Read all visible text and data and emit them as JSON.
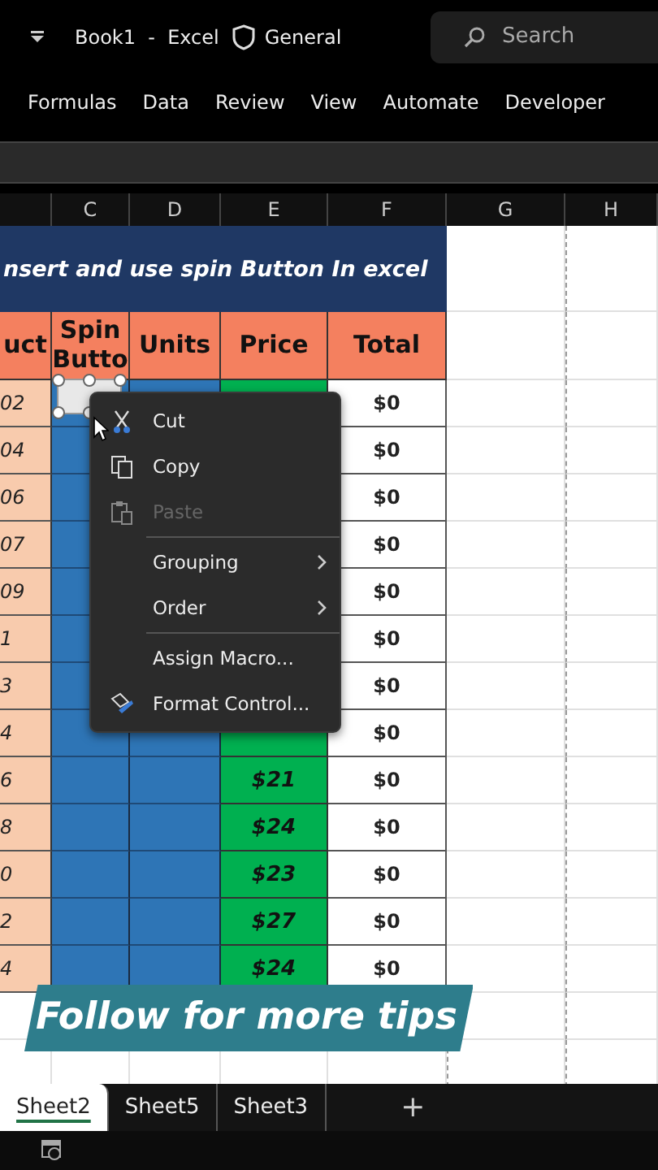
{
  "title_bar": {
    "title": "Book1  -  Excel",
    "sensitivity": "General",
    "search": {
      "placeholder": "Search"
    }
  },
  "ribbon": {
    "tabs": [
      "Formulas",
      "Data",
      "Review",
      "View",
      "Automate",
      "Developer"
    ]
  },
  "columns": [
    "C",
    "D",
    "E",
    "F",
    "G",
    "H"
  ],
  "sheet": {
    "title": "nsert and use spin Button In excel",
    "headers": [
      "uct",
      "Spin Butto",
      "Units",
      "Price",
      "Total"
    ],
    "spin_button": {
      "selected": true
    },
    "rows": [
      {
        "product": "02",
        "total": "$0"
      },
      {
        "product": "04",
        "total": "$0"
      },
      {
        "product": "06",
        "total": "$0"
      },
      {
        "product": "07",
        "total": "$0"
      },
      {
        "product": "09",
        "total": "$0"
      },
      {
        "product": "1",
        "total": "$0"
      },
      {
        "product": "3",
        "total": "$0"
      },
      {
        "product": "4",
        "total": "$0"
      },
      {
        "product": "6",
        "price": "$21",
        "total": "$0"
      },
      {
        "product": "8",
        "price": "$24",
        "total": "$0"
      },
      {
        "product": "0",
        "price": "$23",
        "total": "$0"
      },
      {
        "product": "2",
        "price": "$27",
        "total": "$0"
      },
      {
        "product": "4",
        "price": "$24",
        "total": "$0"
      }
    ]
  },
  "context_menu": [
    {
      "kind": "item",
      "label": "Cut",
      "disabled": false,
      "submenu": false
    },
    {
      "kind": "item",
      "label": "Copy",
      "disabled": false,
      "submenu": false
    },
    {
      "kind": "item",
      "label": "Paste",
      "disabled": true,
      "submenu": false
    },
    {
      "kind": "separator"
    },
    {
      "kind": "item",
      "label": "Grouping",
      "disabled": false,
      "submenu": true
    },
    {
      "kind": "item",
      "label": "Order",
      "disabled": false,
      "submenu": true
    },
    {
      "kind": "separator"
    },
    {
      "kind": "item",
      "label": "Assign Macro...",
      "disabled": false,
      "submenu": false
    },
    {
      "kind": "item",
      "label": "Format Control...",
      "disabled": false,
      "submenu": false
    }
  ],
  "caption": "Follow for more tips",
  "sheet_tabs": [
    {
      "label": "Sheet2",
      "selected": true
    },
    {
      "label": "Sheet5",
      "selected": false
    },
    {
      "label": "Sheet3",
      "selected": false
    }
  ],
  "add_sheet": "+"
}
